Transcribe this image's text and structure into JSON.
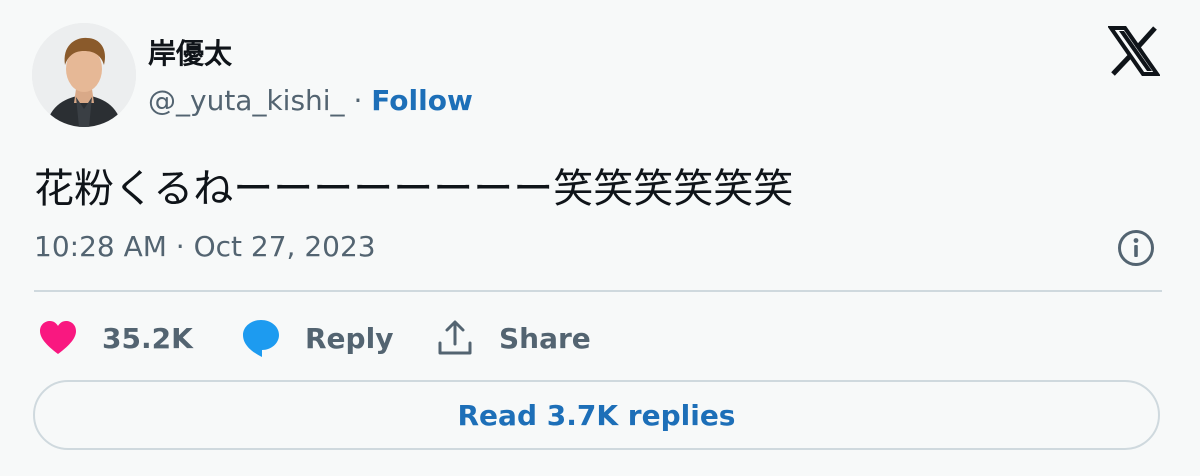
{
  "author": {
    "name": "岸優太",
    "handle": "@_yuta_kishi_",
    "separator": "·",
    "follow_label": "Follow"
  },
  "tweet": {
    "text": "花粉くるねーーーーーーーー笑笑笑笑笑笑",
    "timestamp": "10:28 AM · Oct 27, 2023"
  },
  "actions": {
    "likes_count": "35.2K",
    "reply_label": "Reply",
    "share_label": "Share"
  },
  "read_replies_label": "Read 3.7K replies",
  "icons": {
    "avatar": "profile-photo",
    "logo": "x-logo-icon",
    "info": "info-icon",
    "like": "heart-icon",
    "reply": "speech-bubble-icon",
    "share": "share-upload-icon"
  },
  "colors": {
    "background": "#f7f9f9",
    "link_blue": "#1d6fb8",
    "like_pink": "#f91880",
    "reply_blue": "#1d9bf0",
    "secondary_text": "#536471",
    "divider": "#cfd9de"
  }
}
